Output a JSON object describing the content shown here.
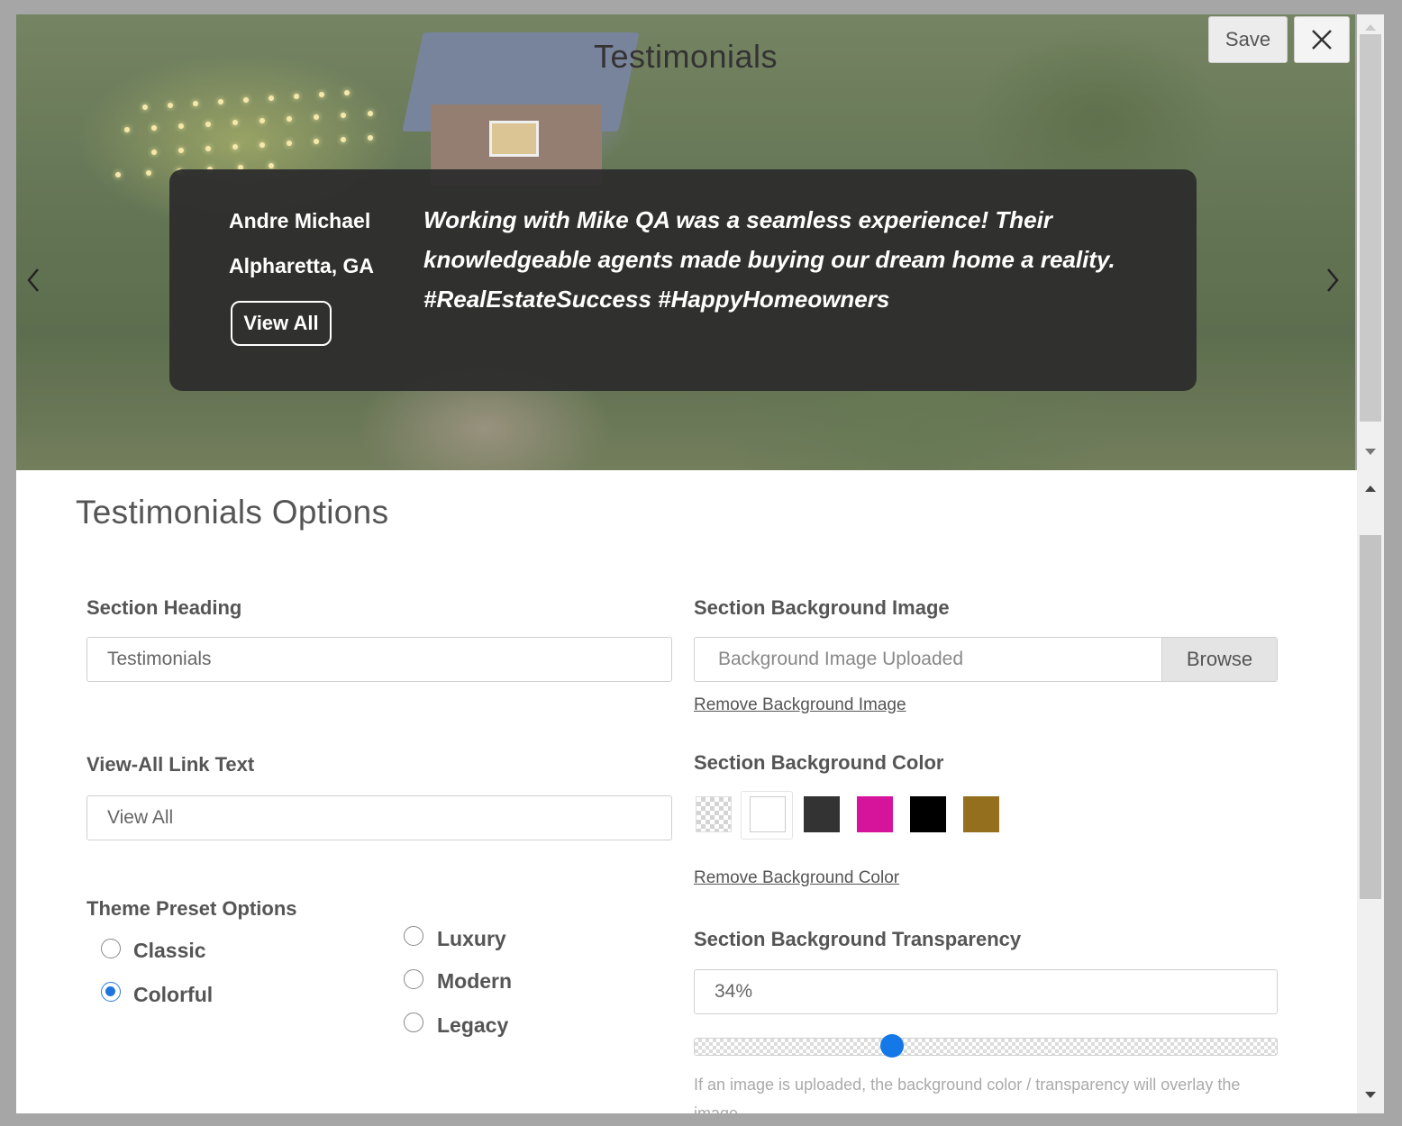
{
  "preview": {
    "title": "Testimonials",
    "save_label": "Save",
    "testimonial": {
      "author": "Andre Michael",
      "location": "Alpharetta, GA",
      "view_all_label": "View All",
      "quote": "Working with Mike QA was a seamless experience! Their knowledgeable agents made buying our dream home a reality. #RealEstateSuccess #HappyHomeowners"
    }
  },
  "options": {
    "title": "Testimonials Options",
    "section_heading": {
      "label": "Section Heading",
      "value": "Testimonials"
    },
    "view_all_link": {
      "label": "View-All Link Text",
      "value": "View All"
    },
    "theme_presets": {
      "label": "Theme Preset Options",
      "options": [
        {
          "label": "Classic",
          "checked": false
        },
        {
          "label": "Colorful",
          "checked": true
        },
        {
          "label": "Luxury",
          "checked": false
        },
        {
          "label": "Modern",
          "checked": false
        },
        {
          "label": "Legacy",
          "checked": false
        }
      ]
    },
    "background_image": {
      "label": "Section Background Image",
      "value": "Background Image Uploaded",
      "browse_label": "Browse",
      "remove_label": "Remove Background Image"
    },
    "background_color": {
      "label": "Section Background Color",
      "swatches": [
        "transparent",
        "#ffffff",
        "#333333",
        "#d6149b",
        "#000000",
        "#94701e"
      ],
      "selected": "#ffffff",
      "remove_label": "Remove Background Color"
    },
    "transparency": {
      "label": "Section Background Transparency",
      "value": "34%",
      "level": 0.34,
      "hint": "If an image is uploaded, the background color / transparency will overlay the image."
    }
  }
}
